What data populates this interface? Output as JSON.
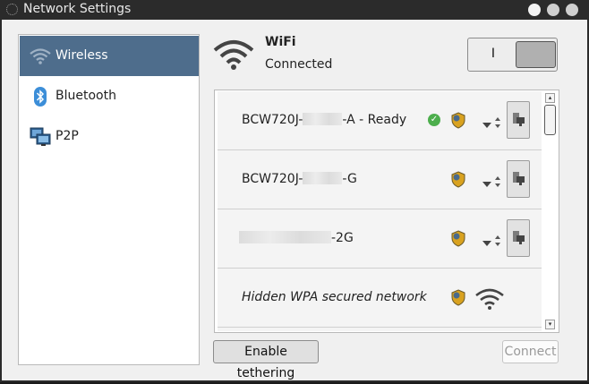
{
  "window": {
    "title": "Network Settings"
  },
  "sidebar": {
    "items": [
      {
        "label": "Wireless",
        "icon": "wifi-icon",
        "active": true
      },
      {
        "label": "Bluetooth",
        "icon": "bluetooth-icon",
        "active": false
      },
      {
        "label": "P2P",
        "icon": "p2p-icon",
        "active": false
      }
    ]
  },
  "header": {
    "title": "WiFi",
    "status": "Connected",
    "toggle_label": "I",
    "toggle_on": true
  },
  "networks": [
    {
      "name_prefix": "BCW720J-",
      "name_suffix": "-A - Ready",
      "connected": true,
      "secured": true
    },
    {
      "name_prefix": "BCW720J-",
      "name_suffix": "-G",
      "connected": false,
      "secured": true
    },
    {
      "name_prefix": "",
      "name_suffix": "-2G",
      "connected": false,
      "secured": true
    },
    {
      "name": "Hidden WPA secured network",
      "hidden": true,
      "secured": true
    }
  ],
  "scrollbar": {
    "up_arrow": "▴",
    "down_arrow": "▾"
  },
  "footer": {
    "tether_label": "Enable tethering",
    "connect_label": "Connect",
    "connect_enabled": false
  },
  "colors": {
    "accent": "#4e6d8c",
    "check": "#4cae4c",
    "shield": "#d9a21f"
  }
}
